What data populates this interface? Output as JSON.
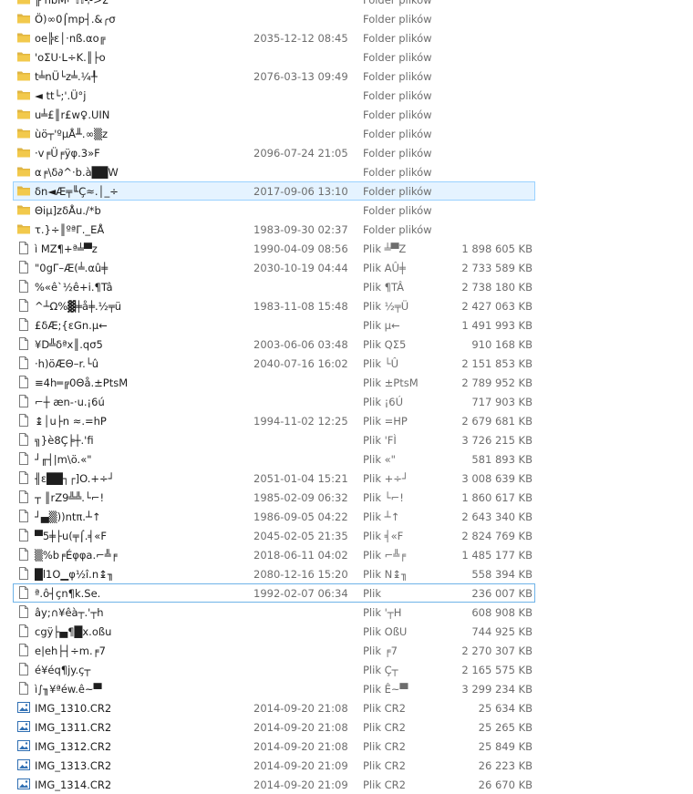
{
  "rows": [
    {
      "kind": "folder",
      "name": "╟ ñbM⌐ℍ⊹>Σ",
      "date": "",
      "type": "Folder plików",
      "size": ""
    },
    {
      "kind": "folder",
      "name": "Ö)∞0⌠mp┤.&╭σ",
      "date": "",
      "type": "Folder plików",
      "size": ""
    },
    {
      "kind": "folder",
      "name": "oe╠ε│·nß.αo╔",
      "date": "2035-12-12 08:45",
      "type": "Folder plików",
      "size": ""
    },
    {
      "kind": "folder",
      "name": "'oΣU·L÷K.║├o",
      "date": "",
      "type": "Folder plików",
      "size": ""
    },
    {
      "kind": "folder",
      "name": "t╧nÜ└z╧.¼╀",
      "date": "2076-03-13 09:49",
      "type": "Folder plików",
      "size": ""
    },
    {
      "kind": "folder",
      "name": "◄ tt└;'.Ü°j",
      "date": "",
      "type": "Folder plików",
      "size": ""
    },
    {
      "kind": "folder",
      "name": "u╧£║r£w♀.UIN",
      "date": "",
      "type": "Folder plików",
      "size": ""
    },
    {
      "kind": "folder",
      "name": "ùö┬'ºµÅ╨.∞▒z",
      "date": "",
      "type": "Folder plików",
      "size": ""
    },
    {
      "kind": "folder",
      "name": "·v╒Ü╒ÿφ.3»F",
      "date": "2096-07-24 21:05",
      "type": "Folder plików",
      "size": ""
    },
    {
      "kind": "folder",
      "name": "α╒\\δ∂^·b.à██W",
      "date": "",
      "type": "Folder plików",
      "size": ""
    },
    {
      "kind": "folder",
      "name": "δn◄Æ╤╙Ç≈.│_÷",
      "date": "2017-09-06 13:10",
      "type": "Folder plików",
      "size": "",
      "state": "sel"
    },
    {
      "kind": "folder",
      "name": "Θiµ]zδÅu./*b",
      "date": "",
      "type": "Folder plików",
      "size": ""
    },
    {
      "kind": "folder",
      "name": "τ.}÷║ºªΓ._EÅ",
      "date": "1983-09-30 02:37",
      "type": "Folder plików",
      "size": ""
    },
    {
      "kind": "file",
      "name": "ì  MZ¶+ª╧▀z",
      "date": "1990-04-09 08:56",
      "type": "Plik ╧▀Z",
      "size": "1 898 605 KB"
    },
    {
      "kind": "file",
      "name": "\"0gΓ–Æ(╧.αû╪",
      "date": "2030-10-19 04:44",
      "type": "Plik AÛ╪",
      "size": "2 733 589 KB"
    },
    {
      "kind": "file",
      "name": "%«ê`½ê+i.¶Tâ",
      "date": "",
      "type": "Plik ¶TÂ",
      "size": "2 738 180 KB"
    },
    {
      "kind": "file",
      "name": "^┴Ω%▓╪å╪.½╤ü",
      "date": "1983-11-08 15:48",
      "type": "Plik ½╤Ü",
      "size": "2 427 063 KB"
    },
    {
      "kind": "file",
      "name": "£δÆ;{εGn.µ←",
      "date": "",
      "type": "Plik µ←",
      "size": "1 491 993 KB"
    },
    {
      "kind": "file",
      "name": "¥D╩δªx║.qσ5",
      "date": "2003-06-06 03:48",
      "type": "Plik QΣ5",
      "size": "910 168 KB"
    },
    {
      "kind": "file",
      "name": "·h)öÆΘ–r.└û",
      "date": "2040-07-16 16:02",
      "type": "Plik └Û",
      "size": "2 151 853 KB"
    },
    {
      "kind": "file",
      "name": "≡4h═╔0Θå.±PtsM",
      "date": "",
      "type": "Plik ±PtsM",
      "size": "2 789 952 KB"
    },
    {
      "kind": "file",
      "name": "⌐┼ æn-·u.¡6ú",
      "date": "",
      "type": "Plik ¡6Ú",
      "size": "717 903 KB"
    },
    {
      "kind": "file",
      "name": "↨│u├n ≈.=hP",
      "date": "1994-11-02 12:25",
      "type": "Plik =HP",
      "size": "2 679 681 KB"
    },
    {
      "kind": "file",
      "name": "╗}è8Ç╞┼.'fi",
      "date": "",
      "type": "Plik 'FÌ",
      "size": "3 726 215 KB"
    },
    {
      "kind": "file",
      "name": "┘╓┤|m\\ö.«\"",
      "date": "",
      "type": "Plik «\"",
      "size": "581 893 KB"
    },
    {
      "kind": "file",
      "name": "╢ε██┐┌]O.+÷┘",
      "date": "2051-01-04 15:21",
      "type": "Plik +÷┘",
      "size": "3 008 639 KB"
    },
    {
      "kind": "file",
      "name": "┬ ║rZ9╩╩.└⌐!",
      "date": "1985-02-09 06:32",
      "type": "Plik └⌐!",
      "size": "1 860 617 KB"
    },
    {
      "kind": "file",
      "name": "┘▄▒))ntπ.┴↑",
      "date": "1986-09-05 04:22",
      "type": "Plik ┴↑",
      "size": "2 643 340 KB"
    },
    {
      "kind": "file",
      "name": "▀5╪├u(╤⌠.╡«F",
      "date": "2045-02-05 21:35",
      "type": "Plik ╡«F",
      "size": "2 824 769 KB"
    },
    {
      "kind": "file",
      "name": "▒%b╒Éφφa.⌐╩╒",
      "date": "2018-06-11 04:02",
      "type": "Plik ⌐╩╒",
      "size": "1 485 177 KB"
    },
    {
      "kind": "file",
      "name": "█l1O▁φ½î.n↨╖",
      "date": "2080-12-16 15:20",
      "type": "Plik N↨╖",
      "size": "558 394 KB"
    },
    {
      "kind": "file",
      "name": "ª.ô┤çn¶k.Se.",
      "date": "1992-02-07 06:34",
      "type": "Plik",
      "size": "236 007 KB",
      "state": "focus"
    },
    {
      "kind": "file",
      "name": "ây;∩¥êà┬.'┬h",
      "date": "",
      "type": "Plik '┬H",
      "size": "608 908 KB"
    },
    {
      "kind": "file",
      "name": "cgÿ├▄¶█x.oßu",
      "date": "",
      "type": "Plik OßU",
      "size": "744 925 KB"
    },
    {
      "kind": "file",
      "name": "e|eh├┤÷m.╒7",
      "date": "",
      "type": "Plik ╒7",
      "size": "2 270 307 KB"
    },
    {
      "kind": "file",
      "name": "é¥éq¶jy.ç┬",
      "date": "",
      "type": "Plik Ç┬",
      "size": "2 165 575 KB"
    },
    {
      "kind": "file",
      "name": "ì∫╖¥ªéw.ê~▀",
      "date": "",
      "type": "Plik Ê~▀",
      "size": "3 299 234 KB"
    },
    {
      "kind": "image",
      "name": "IMG_1310.CR2",
      "date": "2014-09-20 21:08",
      "type": "Plik CR2",
      "size": "25 634 KB"
    },
    {
      "kind": "image",
      "name": "IMG_1311.CR2",
      "date": "2014-09-20 21:08",
      "type": "Plik CR2",
      "size": "25 265 KB"
    },
    {
      "kind": "image",
      "name": "IMG_1312.CR2",
      "date": "2014-09-20 21:08",
      "type": "Plik CR2",
      "size": "25 849 KB"
    },
    {
      "kind": "image",
      "name": "IMG_1313.CR2",
      "date": "2014-09-20 21:09",
      "type": "Plik CR2",
      "size": "26 223 KB"
    },
    {
      "kind": "image",
      "name": "IMG_1314.CR2",
      "date": "2014-09-20 21:09",
      "type": "Plik CR2",
      "size": "26 670 KB"
    }
  ]
}
